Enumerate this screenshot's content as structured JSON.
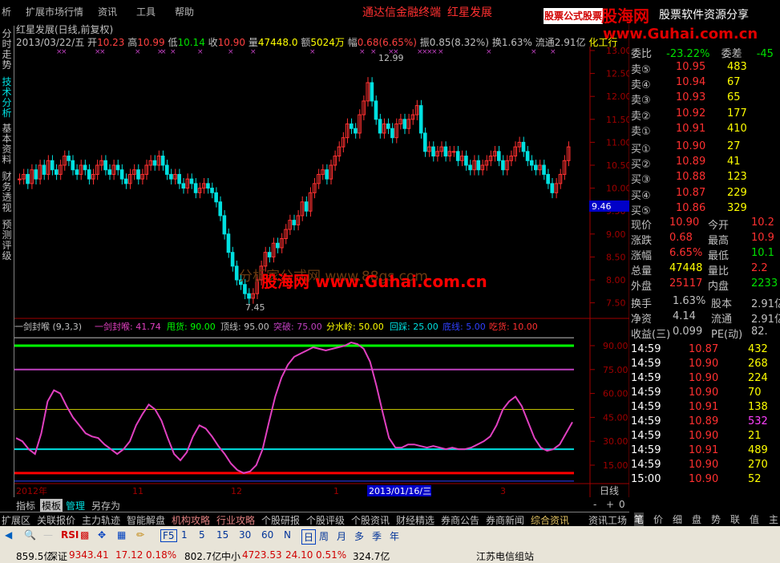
{
  "menu": {
    "items": [
      "析",
      "扩展市场行情",
      "资讯",
      "工具",
      "帮助"
    ],
    "center_title": "通达信金融终端",
    "stock_title": "红星发展",
    "logo_box": "股票公式股票",
    "logo_brand": "股海网",
    "logo_slogan": "股票软件资源分享",
    "logo_url": "www.Guhai.com.cn"
  },
  "left_tabs": [
    "分时走势",
    "技术分析",
    "基本资料",
    "财务透视",
    "预测评级"
  ],
  "info": {
    "name": "红星发展(日线,前复权)",
    "date": "2013/03/22/五",
    "open_l": "开",
    "open": "10.23",
    "high_l": "高",
    "high": "10.99",
    "low_l": "低",
    "low": "10.14",
    "close_l": "收",
    "close": "10.90",
    "vol_l": "量",
    "vol": "47448.0",
    "amt_l": "额",
    "amt": "5024万",
    "chg_l": "幅",
    "chg": "0.68(6.65%)",
    "amp_l": "振",
    "amp": "0.85(8.32%)",
    "turn_l": "换",
    "turn": "1.63%",
    "float_l": "流通",
    "float": "2.91亿",
    "ind": "化工行"
  },
  "price_axis": [
    "13.00",
    "12.50",
    "12.00",
    "11.50",
    "11.00",
    "10.50",
    "10.00",
    "9.50",
    "9.00",
    "8.50",
    "8.00",
    "7.50"
  ],
  "price_marker": "9.46",
  "high_mark": "12.99",
  "low_mark": "7.45",
  "watermark1": "分析家公式网  www.88gs.com",
  "watermark2": "股海网 www.Guhai.com.cn",
  "indicator": {
    "name": "一剑封喉 (9,3,3)",
    "l1": "一剑封喉: 41.74",
    "l2": "甩货: 90.00",
    "l3": "顶线: 95.00",
    "l4": "突破: 75.00",
    "l5": "分水岭: 50.00",
    "l6": "回踩: 25.00",
    "l7": "底线: 5.00",
    "l8": "吃货: 10.00"
  },
  "ind_axis": [
    "90.00",
    "75.00",
    "60.00",
    "45.00",
    "30.00",
    "15.00"
  ],
  "time_axis": {
    "y2012": "2012年",
    "m11": "11",
    "m12": "12",
    "m1": "1",
    "cursor": "2013/01/16/三",
    "m3": "3",
    "period": "日线"
  },
  "quote": {
    "webi_l": "委比",
    "webi": "-23.22%",
    "wecha_l": "委差",
    "wecha": "-45",
    "sells": [
      {
        "l": "卖⑤",
        "p": "10.95",
        "v": "483"
      },
      {
        "l": "卖④",
        "p": "10.94",
        "v": "67"
      },
      {
        "l": "卖③",
        "p": "10.93",
        "v": "65"
      },
      {
        "l": "卖②",
        "p": "10.92",
        "v": "177"
      },
      {
        "l": "卖①",
        "p": "10.91",
        "v": "410"
      }
    ],
    "buys": [
      {
        "l": "买①",
        "p": "10.90",
        "v": "27"
      },
      {
        "l": "买②",
        "p": "10.89",
        "v": "41"
      },
      {
        "l": "买③",
        "p": "10.88",
        "v": "123"
      },
      {
        "l": "买④",
        "p": "10.87",
        "v": "229"
      },
      {
        "l": "买⑤",
        "p": "10.86",
        "v": "329"
      }
    ],
    "stats": [
      {
        "a": "现价",
        "b": "10.90",
        "c": "今开",
        "d": "10.2"
      },
      {
        "a": "涨跌",
        "b": "0.68",
        "c": "最高",
        "d": "10.9"
      },
      {
        "a": "涨幅",
        "b": "6.65%",
        "c": "最低",
        "d": "10.1"
      },
      {
        "a": "总量",
        "b": "47448",
        "c": "量比",
        "d": "2.2"
      },
      {
        "a": "外盘",
        "b": "25117",
        "c": "内盘",
        "d": "2233"
      }
    ],
    "stats2": [
      {
        "a": "换手",
        "b": "1.63%",
        "c": "股本",
        "d": "2.91亿"
      },
      {
        "a": "净资",
        "b": "4.14",
        "c": "流通",
        "d": "2.91亿"
      },
      {
        "a": "收益(三)",
        "b": "0.099",
        "c": "PE(动)",
        "d": "82."
      }
    ],
    "ticks": [
      {
        "t": "14:59",
        "p": "10.87",
        "v": "432"
      },
      {
        "t": "14:59",
        "p": "10.90",
        "v": "268"
      },
      {
        "t": "14:59",
        "p": "10.90",
        "v": "224"
      },
      {
        "t": "14:59",
        "p": "10.90",
        "v": "70"
      },
      {
        "t": "14:59",
        "p": "10.91",
        "v": "138"
      },
      {
        "t": "14:59",
        "p": "10.89",
        "v": "532"
      },
      {
        "t": "14:59",
        "p": "10.90",
        "v": "21"
      },
      {
        "t": "14:59",
        "p": "10.91",
        "v": "489"
      },
      {
        "t": "14:59",
        "p": "10.90",
        "v": "270"
      },
      {
        "t": "15:00",
        "p": "10.90",
        "v": "52"
      }
    ]
  },
  "bottom_tabs": [
    "指标",
    "模板",
    "管理",
    "另存为"
  ],
  "nav_buttons": [
    "-",
    "+",
    "0"
  ],
  "sections": [
    "扩展区",
    "关联报价",
    "主力轨迹",
    "智能解盘",
    "机构攻略",
    "行业攻略",
    "个股研报",
    "个股评级",
    "个股资讯",
    "财经精选",
    "券商公告",
    "券商新闻",
    "综合资讯",
    "资讯工场"
  ],
  "right_tabs": [
    "笔",
    "价",
    "细",
    "盘",
    "势",
    "联",
    "值",
    "主"
  ],
  "toolbar": {
    "rsi": "RSI",
    "f5": "F5",
    "periods": [
      "1",
      "5",
      "15",
      "30",
      "60",
      "N",
      "日",
      "周",
      "月",
      "多",
      "季",
      "年"
    ]
  },
  "status": {
    "s1": "859.5亿",
    "idx_l": "深证",
    "idx": "9343.41",
    "chg": "17.12",
    "pct": "0.18%",
    "amt": "802.7亿",
    "idx2_l": "中小",
    "idx2": "4723.53",
    "chg2": "24.10",
    "pct2": "0.51%",
    "amt2": "324.7亿",
    "broker": "江苏电信组站"
  }
}
